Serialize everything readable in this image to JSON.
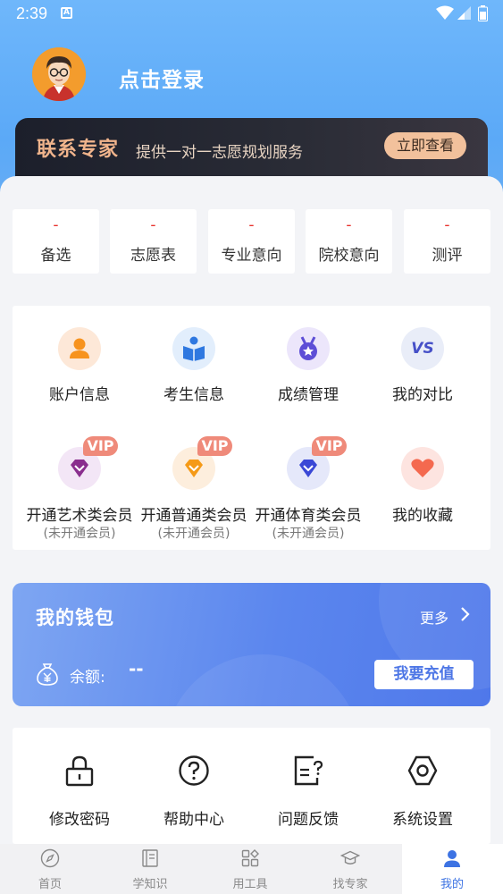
{
  "status_bar": {
    "time": "2:39",
    "notif": "A"
  },
  "profile": {
    "login_label": "点击登录"
  },
  "expert": {
    "title": "联系专家",
    "subtitle": "提供一对一志愿规划服务",
    "button": "立即查看"
  },
  "stats": [
    {
      "value": "-",
      "label": "备选"
    },
    {
      "value": "-",
      "label": "志愿表"
    },
    {
      "value": "-",
      "label": "专业意向"
    },
    {
      "value": "-",
      "label": "院校意向"
    },
    {
      "value": "-",
      "label": "测评"
    }
  ],
  "features": [
    {
      "label": "账户信息",
      "icon": "user-icon"
    },
    {
      "label": "考生信息",
      "icon": "student-icon"
    },
    {
      "label": "成绩管理",
      "icon": "medal-icon"
    },
    {
      "label": "我的对比",
      "icon": "vs-icon",
      "icon_text": "VS"
    }
  ],
  "memberships": [
    {
      "label": "开通艺术类会员",
      "status": "(未开通会员)",
      "badge": "VIP",
      "icon": "diamond-icon"
    },
    {
      "label": "开通普通类会员",
      "status": "(未开通会员)",
      "badge": "VIP",
      "icon": "diamond-icon"
    },
    {
      "label": "开通体育类会员",
      "status": "(未开通会员)",
      "badge": "VIP",
      "icon": "diamond-icon"
    },
    {
      "label": "我的收藏",
      "icon": "heart-icon"
    }
  ],
  "wallet": {
    "title": "我的钱包",
    "more": "更多",
    "balance_label": "余额:",
    "balance_value": "--",
    "recharge": "我要充值"
  },
  "tools": [
    {
      "label": "修改密码",
      "icon": "lock-icon"
    },
    {
      "label": "帮助中心",
      "icon": "help-icon"
    },
    {
      "label": "问题反馈",
      "icon": "feedback-icon"
    },
    {
      "label": "系统设置",
      "icon": "settings-icon"
    }
  ],
  "tabbar": [
    {
      "label": "首页",
      "icon": "compass-icon"
    },
    {
      "label": "学知识",
      "icon": "book-icon"
    },
    {
      "label": "用工具",
      "icon": "tools-icon"
    },
    {
      "label": "找专家",
      "icon": "graduation-cap-icon"
    },
    {
      "label": "我的",
      "icon": "person-icon",
      "active": true
    }
  ],
  "colors": {
    "accent": "#3d73e3",
    "expert_gold": "#f0b48c",
    "stat_red": "#e8302b",
    "vip": "#ef8a7a"
  }
}
